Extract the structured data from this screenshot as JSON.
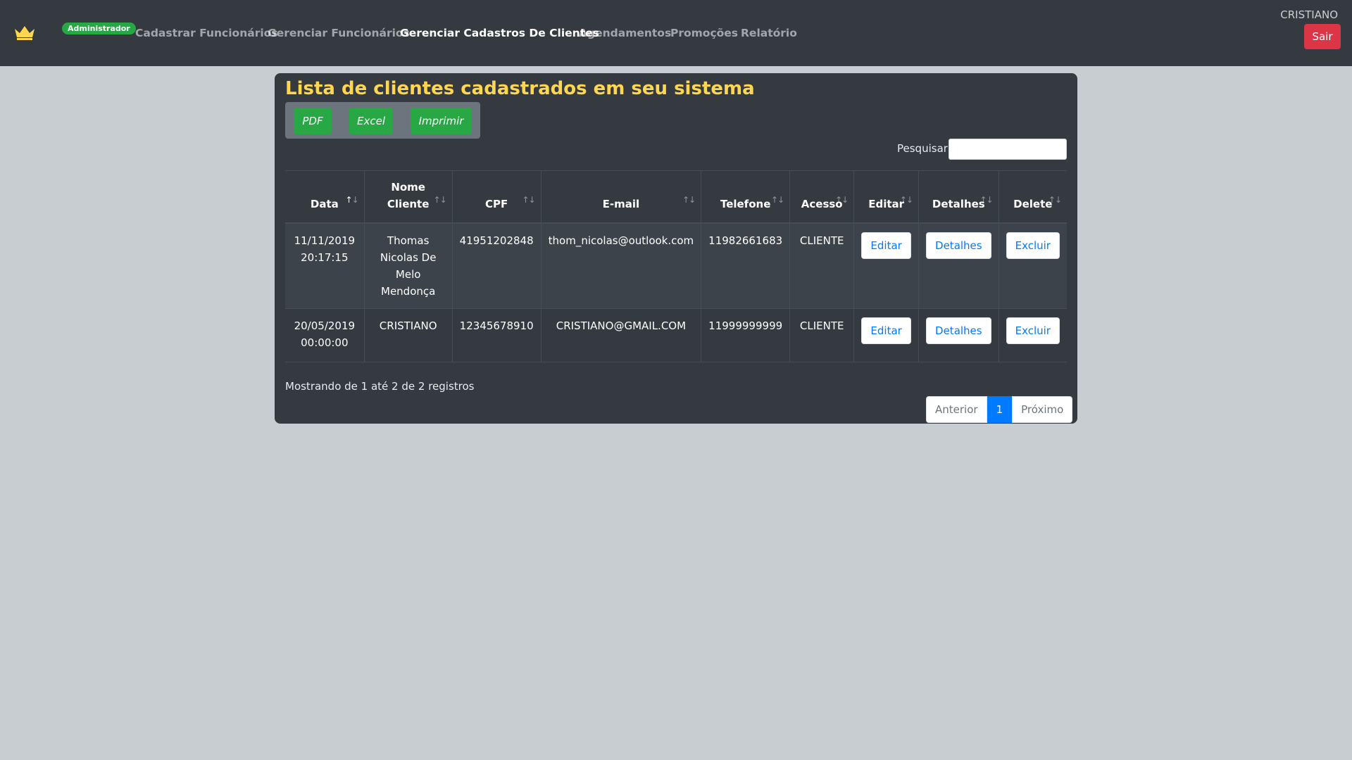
{
  "navbar": {
    "role_badge": "Administrador",
    "links": [
      "Cadastrar Funcionários",
      "Gerenciar Funcionários",
      "Gerenciar Cadastros De Clientes",
      "Agendamentos",
      "Promoções",
      "Relatório"
    ],
    "active_link": "Gerenciar Cadastros De Clientes",
    "user": "CRISTIANO",
    "logout": "Sair",
    "brand_icon": "crown-icon",
    "brand_color": "#ffd64f"
  },
  "card": {
    "title": "Lista de clientes cadastrados em seu sistema",
    "export_buttons": [
      "PDF",
      "Excel",
      "Imprimir"
    ],
    "search_label": "Pesquisar",
    "search_value": ""
  },
  "table": {
    "headers": [
      "Data",
      "Nome Cliente",
      "CPF",
      "E-mail",
      "Telefone",
      "Acesso",
      "Editar",
      "Detalhes",
      "Delete"
    ],
    "sorted_column": "Data",
    "rows": [
      {
        "data": "11/11/2019 20:17:15",
        "nome": "Thomas Nicolas De Melo Mendonça",
        "cpf": "41951202848",
        "email": "thom_nicolas@outlook.com",
        "telefone": "11982661683",
        "acesso": "CLIENTE",
        "editar": "Editar",
        "detalhes": "Detalhes",
        "excluir": "Excluir"
      },
      {
        "data": "20/05/2019 00:00:00",
        "nome": "CRISTIANO",
        "cpf": "12345678910",
        "email": "CRISTIANO@GMAIL.COM",
        "telefone": "11999999999",
        "acesso": "CLIENTE",
        "editar": "Editar",
        "detalhes": "Detalhes",
        "excluir": "Excluir"
      }
    ]
  },
  "footer": {
    "info": "Mostrando de 1 até 2 de 2 registros",
    "pagination": {
      "previous": "Anterior",
      "current": "1",
      "next": "Próximo"
    }
  }
}
